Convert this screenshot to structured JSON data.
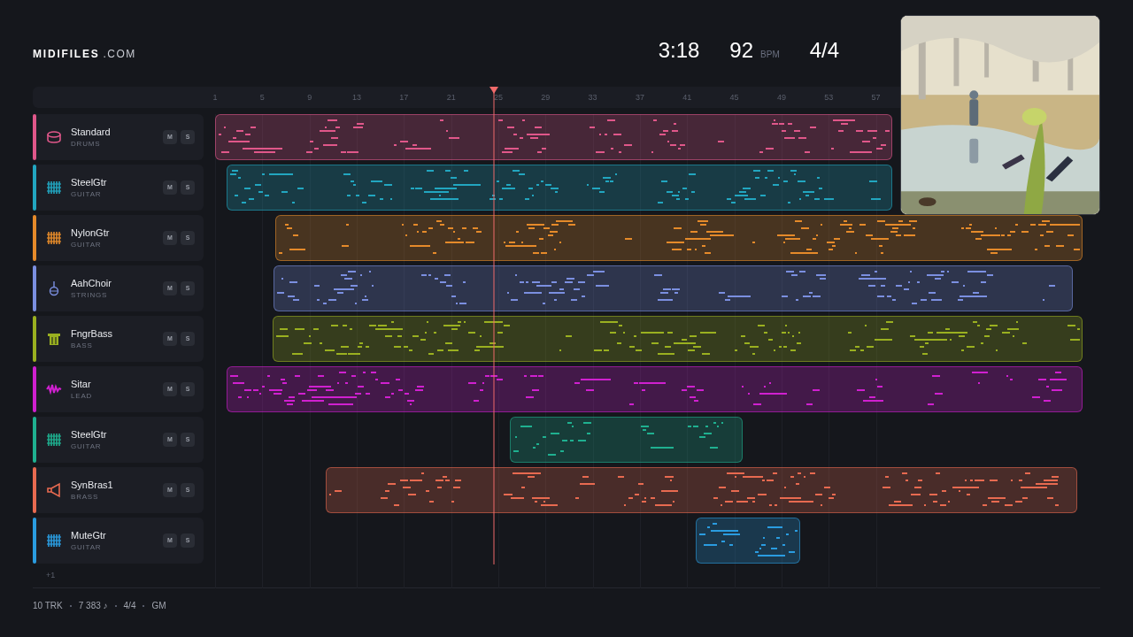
{
  "brand": {
    "name": "MIDIFILES",
    "suffix": ".COM"
  },
  "transport": {
    "time": "3:18",
    "tempo": "92",
    "tempo_unit": "BPM",
    "meter": "4/4"
  },
  "ruler": [
    "1",
    "5",
    "9",
    "13",
    "17",
    "21",
    "25",
    "29",
    "33",
    "37",
    "41",
    "45",
    "49",
    "53",
    "57"
  ],
  "tracks": [
    {
      "name": "Standard",
      "category": "DRUMS",
      "kind": "drums",
      "color": "#e0578a",
      "mute": "M",
      "solo": "S"
    },
    {
      "name": "SteelGtr",
      "category": "GUITAR",
      "kind": "guitar",
      "color": "#22a6c0",
      "mute": "M",
      "solo": "S"
    },
    {
      "name": "NylonGtr",
      "category": "GUITAR",
      "kind": "guitar",
      "color": "#e58a2a",
      "mute": "M",
      "solo": "S"
    },
    {
      "name": "AahChoir",
      "category": "STRINGS",
      "kind": "choir",
      "color": "#7b8fe0",
      "mute": "M",
      "solo": "S"
    },
    {
      "name": "FngrBass",
      "category": "BASS",
      "kind": "bass",
      "color": "#9ab020",
      "mute": "M",
      "solo": "S"
    },
    {
      "name": "Sitar",
      "category": "LEAD",
      "kind": "lead",
      "color": "#d020d0",
      "mute": "M",
      "solo": "S"
    },
    {
      "name": "SteelGtr",
      "category": "GUITAR",
      "kind": "guitar",
      "color": "#1fb090",
      "mute": "M",
      "solo": "S"
    },
    {
      "name": "SynBras1",
      "category": "BRASS",
      "kind": "brass",
      "color": "#e86a50",
      "mute": "M",
      "solo": "S"
    },
    {
      "name": "MuteGtr",
      "category": "GUITAR",
      "kind": "guitar",
      "color": "#2a9ce0",
      "mute": "M",
      "solo": "S"
    }
  ],
  "more_tracks": "+1",
  "footer": [
    "10 TRK",
    "7 383 ♪",
    "4/4",
    "GM"
  ]
}
